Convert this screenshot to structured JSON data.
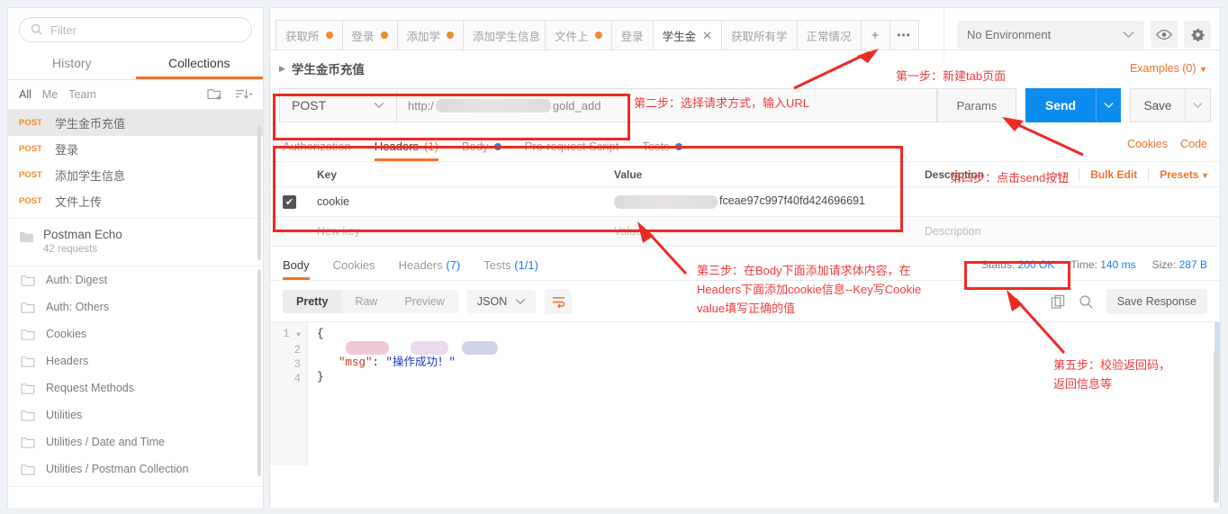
{
  "sidebar": {
    "filter_placeholder": "Filter",
    "tabs": [
      {
        "label": "History",
        "active": false
      },
      {
        "label": "Collections",
        "active": true
      }
    ],
    "scope_filters": [
      {
        "label": "All",
        "selected": true
      },
      {
        "label": "Me",
        "selected": false
      },
      {
        "label": "Team",
        "selected": false
      }
    ],
    "requests": [
      {
        "method": "POST",
        "name": "学生金币充值",
        "selected": true
      },
      {
        "method": "POST",
        "name": "登录",
        "selected": false
      },
      {
        "method": "POST",
        "name": "添加学生信息",
        "selected": false
      },
      {
        "method": "POST",
        "name": "文件上传",
        "selected": false
      }
    ],
    "collection": {
      "title": "Postman Echo",
      "subtitle": "42 requests"
    },
    "folders": [
      "Auth: Digest",
      "Auth: Others",
      "Cookies",
      "Headers",
      "Request Methods",
      "Utilities",
      "Utilities / Date and Time",
      "Utilities / Postman Collection"
    ]
  },
  "tabbar": {
    "tabs": [
      {
        "label": "获取所",
        "dirty": true,
        "active": false,
        "closable": false
      },
      {
        "label": "登录",
        "dirty": true,
        "active": false,
        "closable": false
      },
      {
        "label": "添加学",
        "dirty": true,
        "active": false,
        "closable": false
      },
      {
        "label": "添加学生信息",
        "dirty": false,
        "active": false,
        "closable": false
      },
      {
        "label": "文件上",
        "dirty": true,
        "active": false,
        "closable": false
      },
      {
        "label": "登录",
        "dirty": false,
        "active": false,
        "closable": false
      },
      {
        "label": "学生金",
        "dirty": false,
        "active": true,
        "closable": true
      },
      {
        "label": "获取所有学",
        "dirty": false,
        "active": false,
        "closable": false
      },
      {
        "label": "正常情况",
        "dirty": false,
        "active": false,
        "closable": false
      }
    ],
    "new_tab_label": "+",
    "more_label": "•••"
  },
  "environment": {
    "selected": "No Environment",
    "eye_icon": "eye-icon",
    "settings_icon": "gear-icon"
  },
  "breadcrumb": {
    "name": "学生金币充值",
    "examples_label": "Examples (0)"
  },
  "request": {
    "method": "POST",
    "url_prefix": "http:/",
    "url_suffix": "gold_add",
    "params_label": "Params",
    "send_label": "Send",
    "save_label": "Save",
    "tabs": [
      {
        "label": "Authorization",
        "active": false,
        "count": null,
        "dot": false
      },
      {
        "label": "Headers",
        "active": true,
        "count": "(1)",
        "dot": false
      },
      {
        "label": "Body",
        "active": false,
        "count": null,
        "dot": true
      },
      {
        "label": "Pre-request Script",
        "active": false,
        "count": null,
        "dot": false
      },
      {
        "label": "Tests",
        "active": false,
        "count": null,
        "dot": true
      }
    ],
    "links": [
      "Cookies",
      "Code"
    ],
    "headers_table": {
      "columns": [
        "Key",
        "Value",
        "Description"
      ],
      "rows": [
        {
          "checked": true,
          "key": "cookie",
          "value_suffix": "fceae97c997f40fd424696691",
          "description": ""
        }
      ],
      "new_row": {
        "key_placeholder": "New key",
        "value_placeholder": "Value",
        "description_placeholder": "Description"
      },
      "tools": {
        "dots": "•••",
        "bulk_edit": "Bulk Edit",
        "presets": "Presets"
      }
    }
  },
  "response": {
    "tabs": [
      {
        "label": "Body",
        "count": null,
        "active": true
      },
      {
        "label": "Cookies",
        "count": null,
        "active": false
      },
      {
        "label": "Headers",
        "count": "(7)",
        "active": false
      },
      {
        "label": "Tests",
        "count": "(1/1)",
        "active": false
      }
    ],
    "status_label": "Status:",
    "status_value": "200 OK",
    "time_label": "Time:",
    "time_value": "140 ms",
    "size_label": "Size:",
    "size_value": "287 B",
    "view_modes": [
      {
        "label": "Pretty",
        "active": true
      },
      {
        "label": "Raw",
        "active": false
      },
      {
        "label": "Preview",
        "active": false
      }
    ],
    "format": "JSON",
    "wrap_icon": "word-wrap-icon",
    "copy_icon": "copy-icon",
    "search_icon": "search-icon",
    "save_response_label": "Save Response",
    "body_lines": [
      {
        "number": "1",
        "content": "{",
        "redacted": false
      },
      {
        "number": "2",
        "content": "",
        "redacted": true
      },
      {
        "number": "3",
        "key": "\"msg\"",
        "sep": ": ",
        "value": "\"操作成功！\"",
        "redacted": false
      },
      {
        "number": "4",
        "content": "}",
        "redacted": false
      }
    ]
  },
  "annotations": [
    {
      "id": "step1",
      "text": "第一步：新建tab页面"
    },
    {
      "id": "step2",
      "text": "第二步：选择请求方式，输入URL"
    },
    {
      "id": "step3",
      "text": "第三步：在Body下面添加请求体内容，在\nHeaders下面添加cookie信息--Key写Cookie\nvalue填写正确的值"
    },
    {
      "id": "step4",
      "text": "第四步：点击send按钮"
    },
    {
      "id": "step5",
      "text": "第五步：校验返回码，\n返回信息等"
    }
  ],
  "colors": {
    "accent_orange": "#f2722b",
    "send_blue": "#0d8cf0",
    "annotation_red": "#ef3b3b",
    "box_red": "#ee2a24"
  }
}
